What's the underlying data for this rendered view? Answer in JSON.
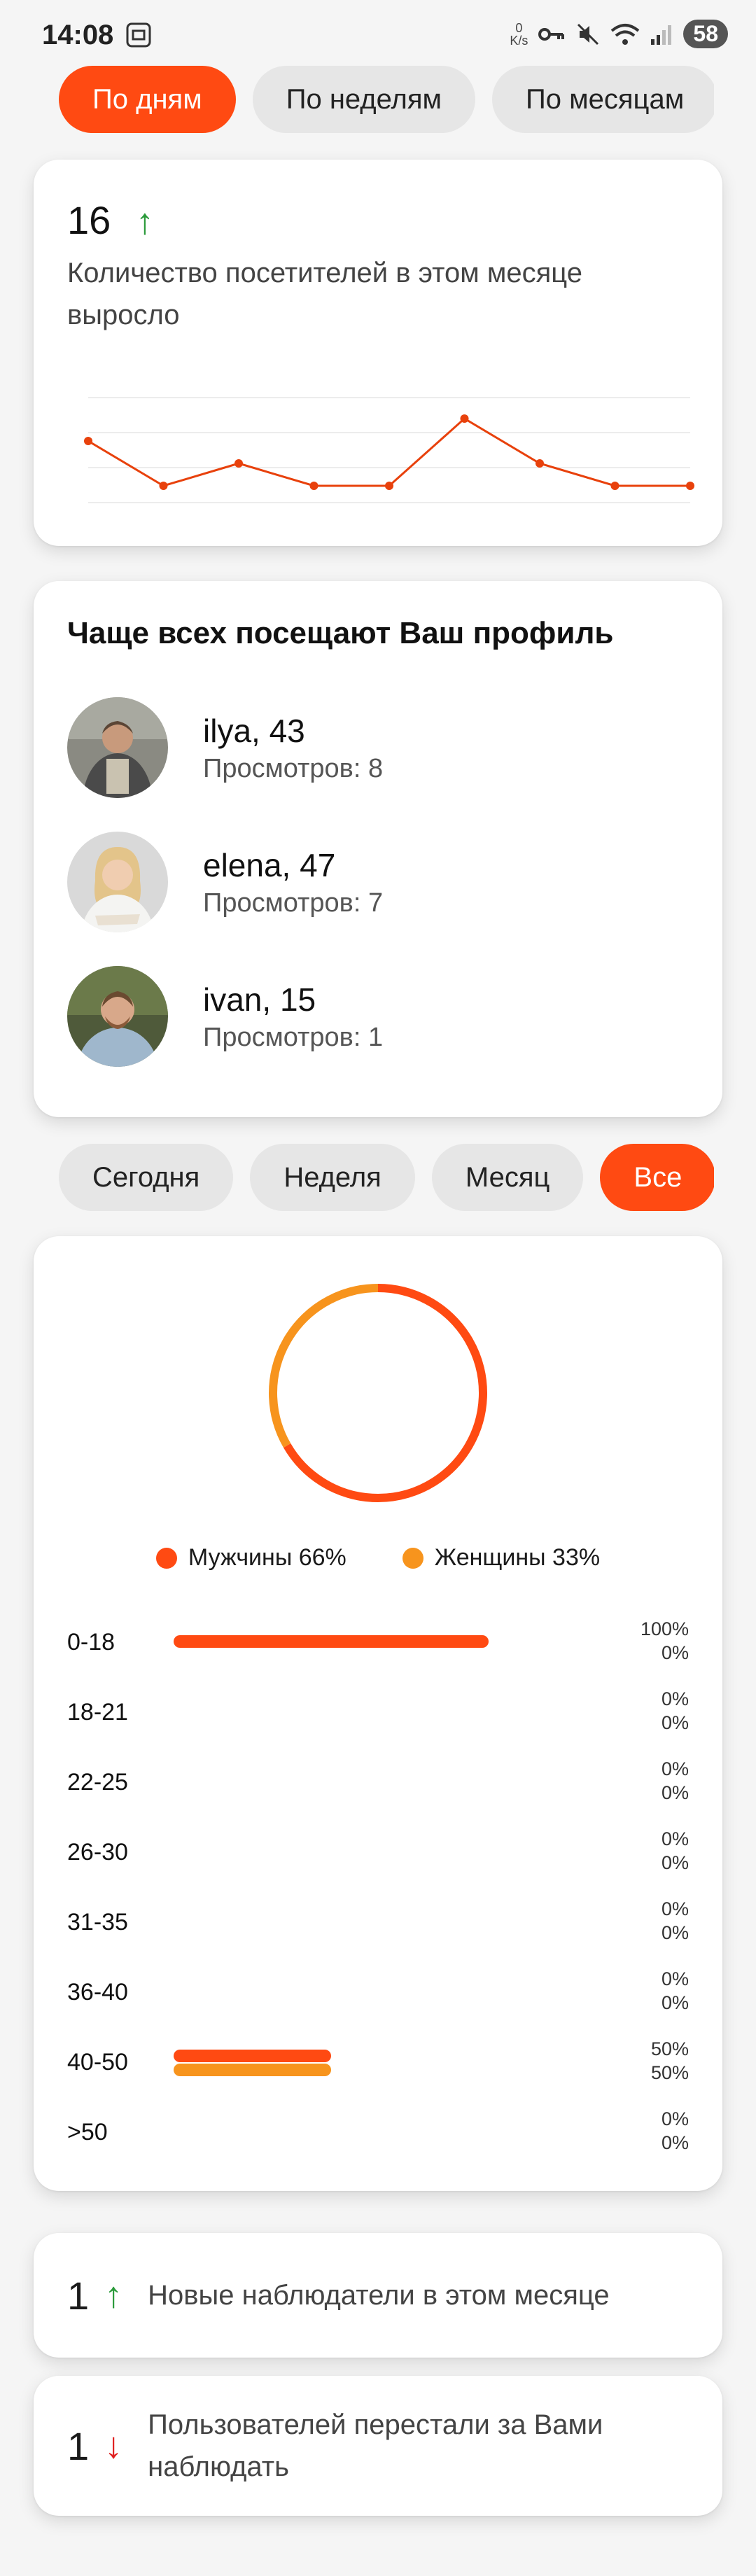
{
  "status": {
    "time": "14:08",
    "net_value": "0",
    "net_unit": "K/s",
    "battery": "58"
  },
  "period_tabs": [
    "По дням",
    "По неделям",
    "По месяцам"
  ],
  "visitors_card": {
    "count": "16",
    "arrow": "↑",
    "text": "Количество посетителей в этом месяце выросло"
  },
  "chart_data": {
    "type": "line",
    "values": [
      3,
      1,
      2,
      1,
      1,
      4,
      2,
      1,
      1
    ],
    "ylim": [
      0,
      5
    ],
    "color": "#e8410c",
    "grid": true
  },
  "top_visitors": {
    "title": "Чаще всех посещают Ваш профиль",
    "items": [
      {
        "name": "ilya, 43",
        "views": "Просмотров: 8"
      },
      {
        "name": "elena, 47",
        "views": "Просмотров: 7"
      },
      {
        "name": "ivan, 15",
        "views": "Просмотров: 1"
      }
    ]
  },
  "range_tabs": [
    "Сегодня",
    "Неделя",
    "Месяц",
    "Все"
  ],
  "gender": {
    "male_label": "Мужчины 66%",
    "female_label": "Женщины 33%",
    "male_share": 0.66,
    "female_share": 0.33,
    "male_color": "#ff4a12",
    "female_color": "#f7941d"
  },
  "age_groups": [
    {
      "label": "0-18",
      "male": "100%",
      "female": "0%"
    },
    {
      "label": "18-21",
      "male": "0%",
      "female": "0%"
    },
    {
      "label": "22-25",
      "male": "0%",
      "female": "0%"
    },
    {
      "label": "26-30",
      "male": "0%",
      "female": "0%"
    },
    {
      "label": "31-35",
      "male": "0%",
      "female": "0%"
    },
    {
      "label": "36-40",
      "male": "0%",
      "female": "0%"
    },
    {
      "label": "40-50",
      "male": "50%",
      "female": "50%"
    },
    {
      "label": ">50",
      "male": "0%",
      "female": "0%"
    }
  ],
  "new_followers": {
    "count": "1",
    "arrow": "↑",
    "text": "Новые наблюдатели в этом месяце"
  },
  "lost_followers": {
    "count": "1",
    "arrow": "↓",
    "text": "Пользователей перестали за Вами наблюдать"
  }
}
